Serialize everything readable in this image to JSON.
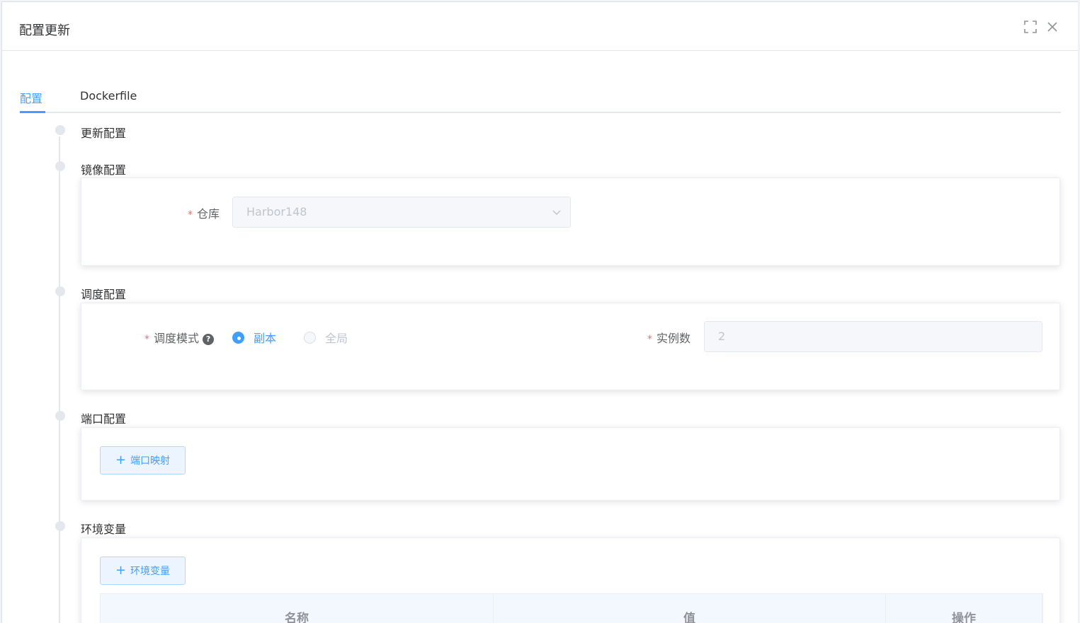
{
  "dialog": {
    "title": "配置更新",
    "fullscreen_icon": "fullscreen-icon",
    "close_icon": "close-icon"
  },
  "tabs": [
    {
      "label": "配置",
      "active": true
    },
    {
      "label": "Dockerfile",
      "active": false
    }
  ],
  "steps": {
    "update": {
      "title": "更新配置"
    },
    "image": {
      "title": "镜像配置",
      "repo_label": "仓库",
      "repo_value": "Harbor148"
    },
    "schedule": {
      "title": "调度配置",
      "mode_label": "调度模式",
      "help_icon": "question-circle-icon",
      "mode_options": [
        {
          "label": "副本",
          "checked": true
        },
        {
          "label": "全局",
          "checked": false
        }
      ],
      "instances_label": "实例数",
      "instances_value": "2"
    },
    "ports": {
      "title": "端口配置",
      "add_button": "端口映射"
    },
    "env": {
      "title": "环境变量",
      "add_button": "环境变量",
      "table_headers": [
        "名称",
        "值",
        "操作"
      ]
    }
  },
  "colors": {
    "accent": "#409eff",
    "required": "#f56c6c"
  }
}
